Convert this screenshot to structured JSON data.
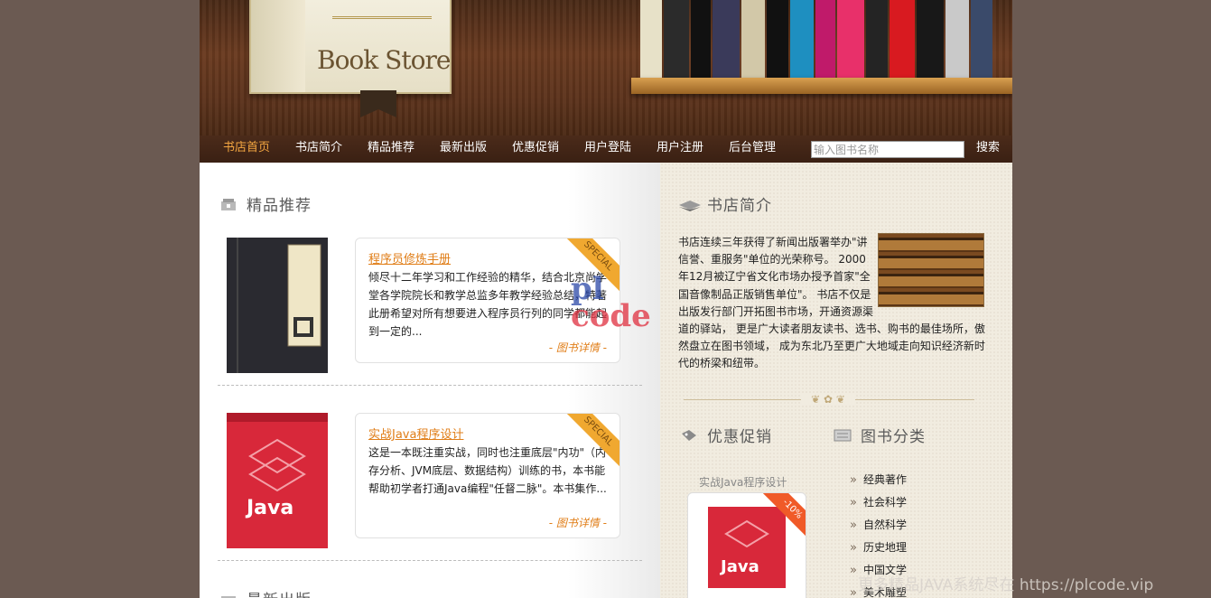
{
  "header": {
    "logo_title": "Book Store"
  },
  "nav": {
    "items": [
      "书店首页",
      "书店简介",
      "精品推荐",
      "最新出版",
      "优惠促销",
      "用户登陆",
      "用户注册",
      "后台管理"
    ],
    "search_placeholder": "输入图书名称",
    "search_button": "搜索"
  },
  "featured": {
    "title": "精品推荐",
    "badge": "SPECIAL",
    "books": [
      {
        "title": "程序员修炼手册",
        "desc": "倾尽十二年学习和工作经验的精华，结合北京尚学堂各学院院长和教学总监多年教学经验总结，特著此册希望对所有想要进入程序员行列的同学都能起到一定的...",
        "more": "- 图书详情 -"
      },
      {
        "title": "实战Java程序设计",
        "desc": "这是一本既注重实战，同时也注重底层\"内功\"（内存分析、JVM底层、数据结构）训练的书，本书能帮助初学者打通Java编程\"任督二脉\"。本书集作...",
        "more": "- 图书详情 -"
      }
    ]
  },
  "latest": {
    "title": "最新出版"
  },
  "about": {
    "title": "书店简介",
    "text": "书店连续三年获得了新闻出版署举办\"讲信誉、重服务\"单位的光荣称号。 2000年12月被辽宁省文化市场办授予首家\"全国音像制品正版销售单位\"。 书店不仅是出版发行部门开拓图书市场，开通资源渠道的驿站， 更是广大读者朋友读书、选书、购书的最佳场所，傲然盘立在图书领域， 成为东北乃至更广大地域走向知识经济新时代的桥梁和纽带。"
  },
  "promo": {
    "title": "优惠促销",
    "book_label": "实战Java程序设计",
    "discount": "-10%"
  },
  "categories": {
    "title": "图书分类",
    "items": [
      "经典著作",
      "社会科学",
      "自然科学",
      "历史地理",
      "中国文学",
      "美术雕塑"
    ]
  },
  "watermark": {
    "logo_top": "pl",
    "logo_bottom": "code",
    "text": "更多精品JAVA系统尽在 https://plcode.vip"
  },
  "colors": {
    "accent": "#e07e18",
    "nav_active": "#f3a641",
    "nav_bg": "#3a2013",
    "page_bg": "#6b5a52"
  }
}
